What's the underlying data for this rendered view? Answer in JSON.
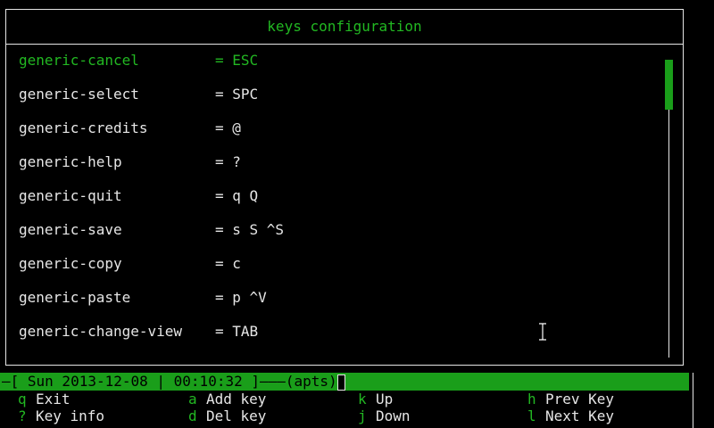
{
  "window": {
    "title": "keys configuration"
  },
  "keys": [
    {
      "name": "generic-cancel",
      "value": "= ESC"
    },
    {
      "name": "generic-select",
      "value": "= SPC"
    },
    {
      "name": "generic-credits",
      "value": "= @"
    },
    {
      "name": "generic-help",
      "value": "= ?"
    },
    {
      "name": "generic-quit",
      "value": "= q Q"
    },
    {
      "name": "generic-save",
      "value": "= s S ^S"
    },
    {
      "name": "generic-copy",
      "value": "= c"
    },
    {
      "name": "generic-paste",
      "value": "= p ^V"
    },
    {
      "name": "generic-change-view",
      "value": "= TAB"
    }
  ],
  "status": {
    "text": "—[ Sun 2013-12-08 | 00:10:32 ]———(apts)"
  },
  "help": [
    [
      {
        "key": "q",
        "label": "Exit"
      },
      {
        "key": "?",
        "label": "Key info"
      }
    ],
    [
      {
        "key": "a",
        "label": "Add key"
      },
      {
        "key": "d",
        "label": "Del key"
      }
    ],
    [
      {
        "key": "k",
        "label": "Up"
      },
      {
        "key": "j",
        "label": "Down"
      }
    ],
    [
      {
        "key": "h",
        "label": "Prev Key"
      },
      {
        "key": "l",
        "label": "Next Key"
      }
    ]
  ],
  "colors": {
    "accent": "#22b822",
    "status_bg": "#1a9e1a",
    "background": "#000000",
    "text": "#e6e6e6"
  },
  "icons": {
    "pointer": "text-cursor-icon"
  }
}
